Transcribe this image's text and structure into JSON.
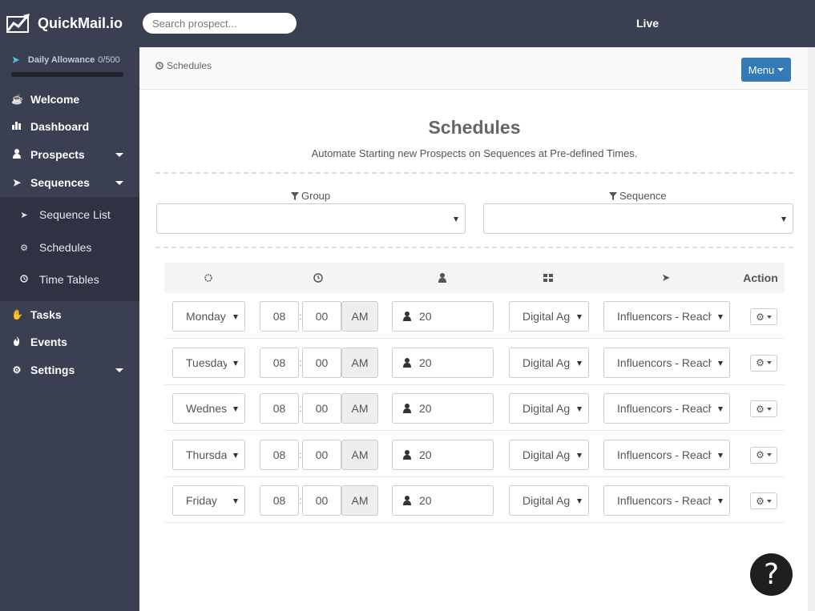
{
  "app": {
    "brand": "QuickMail.io",
    "search_placeholder": "Search prospect...",
    "status": "Live"
  },
  "sidebar": {
    "allowance_label": "Daily Allowance",
    "allowance_count": "0/500",
    "allowance_progress": 0,
    "items": [
      {
        "label": "Welcome",
        "icon": "coffee-icon"
      },
      {
        "label": "Dashboard",
        "icon": "bar-chart-icon"
      },
      {
        "label": "Prospects",
        "icon": "user-icon"
      },
      {
        "label": "Sequences",
        "icon": "paper-plane-icon"
      },
      {
        "label": "Tasks",
        "icon": "hand-icon"
      },
      {
        "label": "Events",
        "icon": "fire-icon"
      },
      {
        "label": "Settings",
        "icon": "gear-icon"
      }
    ],
    "subitems": [
      {
        "label": "Sequence List",
        "icon": "paper-plane-icon"
      },
      {
        "label": "Schedules",
        "icon": "cogs-icon"
      },
      {
        "label": "Time Tables",
        "icon": "clock-icon"
      }
    ]
  },
  "header": {
    "breadcrumb": "Schedules",
    "menu_label": "Menu"
  },
  "page": {
    "title": "Schedules",
    "subtitle": "Automate Starting new Prospects on Sequences at Pre-defined Times.",
    "filters": {
      "group_label": "Group",
      "sequence_label": "Sequence"
    }
  },
  "table": {
    "action_header": "Action",
    "rows": [
      {
        "day": "Monday",
        "hour": "08",
        "minute": "00",
        "ampm": "AM",
        "count": "20",
        "group": "Digital Agencies",
        "sequence": "Influencors - Reach Out"
      },
      {
        "day": "Tuesday",
        "hour": "08",
        "minute": "00",
        "ampm": "AM",
        "count": "20",
        "group": "Digital Agencies",
        "sequence": "Influencors - Reach Out"
      },
      {
        "day": "Wednesday",
        "hour": "08",
        "minute": "00",
        "ampm": "AM",
        "count": "20",
        "group": "Digital Agencies",
        "sequence": "Influencors - Reach Out"
      },
      {
        "day": "Thursday",
        "hour": "08",
        "minute": "00",
        "ampm": "AM",
        "count": "20",
        "group": "Digital Agencies",
        "sequence": "Influencors - Reach Out"
      },
      {
        "day": "Friday",
        "hour": "08",
        "minute": "00",
        "ampm": "AM",
        "count": "20",
        "group": "Digital Agencies",
        "sequence": "Influencors - Reach Out"
      }
    ]
  }
}
